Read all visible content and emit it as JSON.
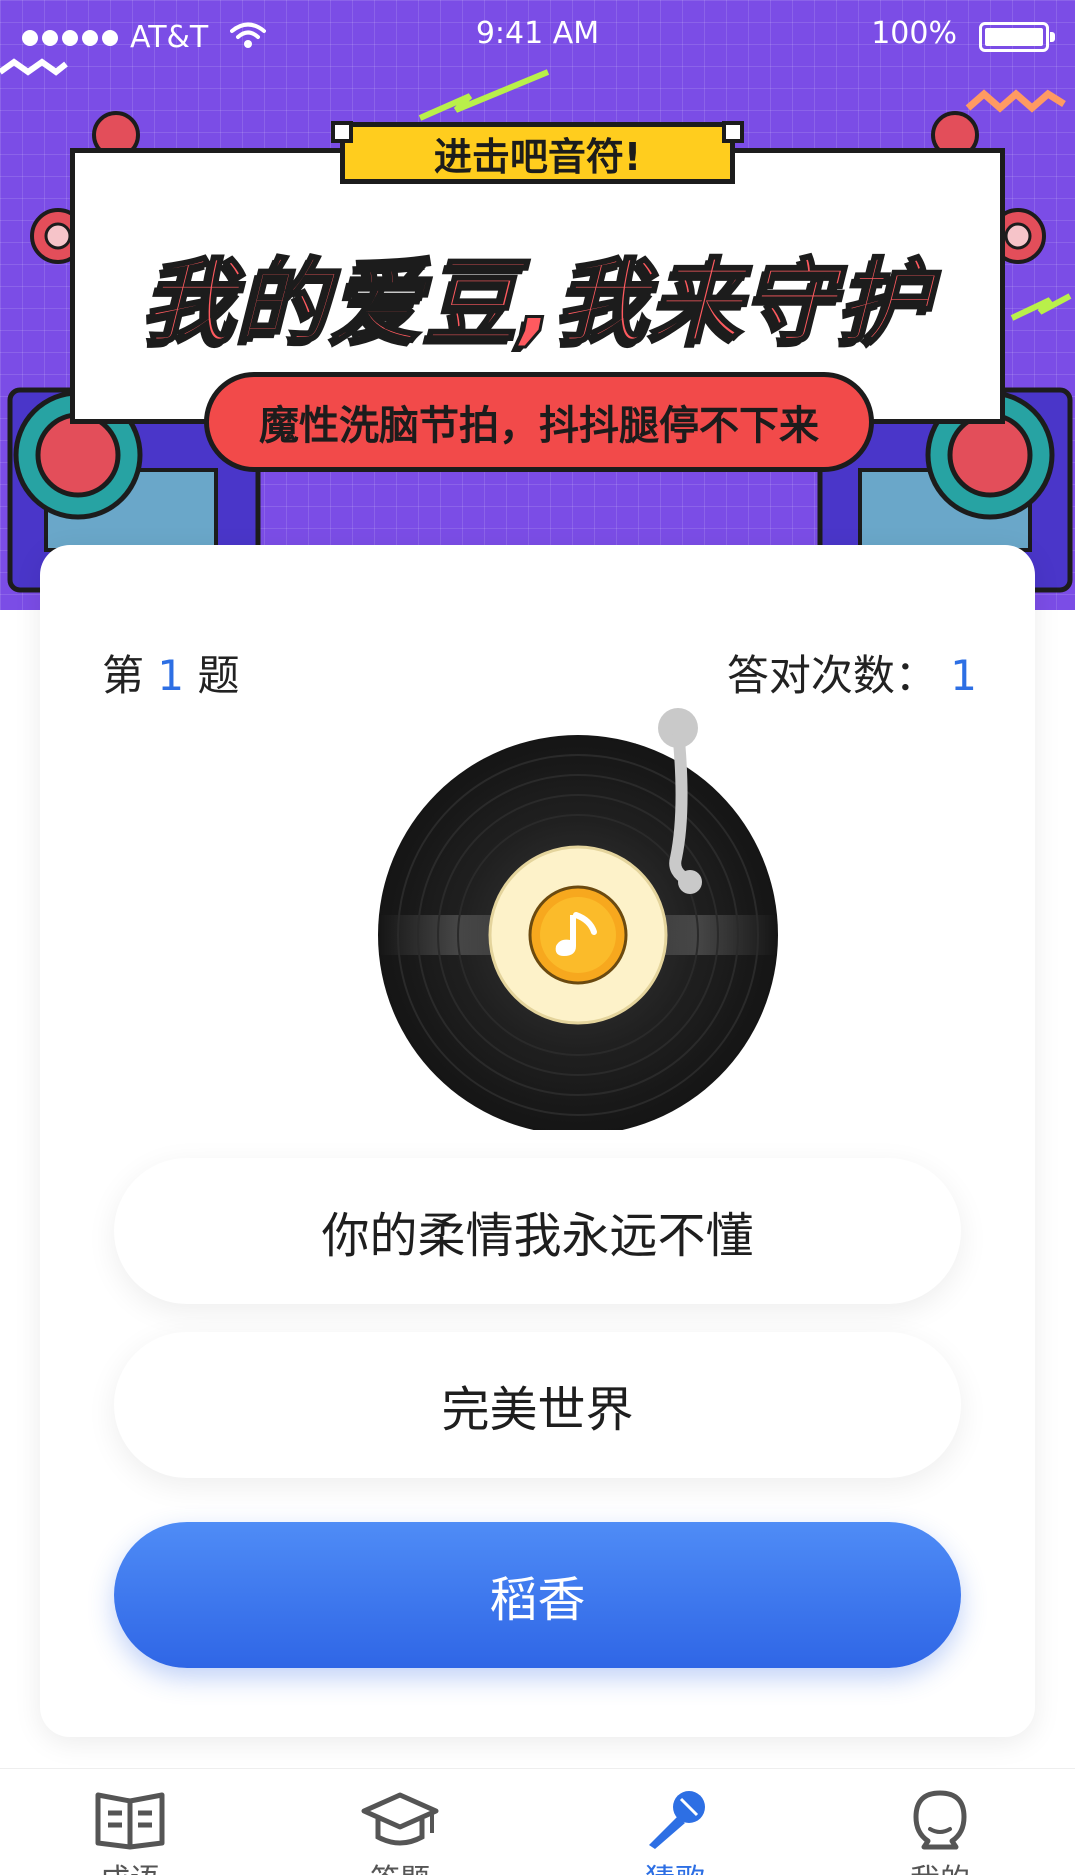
{
  "status_bar": {
    "carrier": "AT&T",
    "time": "9:41 AM",
    "battery": "100%"
  },
  "banner": {
    "tag": "进击吧音符!",
    "headline": "我的爱豆,我来守护",
    "subline": "魔性洗脑节拍，抖抖腿停不下来"
  },
  "quiz": {
    "question_prefix": "第",
    "question_number": "1",
    "question_suffix": "题",
    "correct_label": "答对次数：",
    "correct_count": "1",
    "options": [
      {
        "label": "你的柔情我永远不懂",
        "selected": false
      },
      {
        "label": "完美世界",
        "selected": false
      },
      {
        "label": "稻香",
        "selected": true
      }
    ]
  },
  "tabbar": {
    "items": [
      {
        "label": "成语",
        "icon": "book-icon",
        "active": false
      },
      {
        "label": "答题",
        "icon": "graduation-cap-icon",
        "active": false
      },
      {
        "label": "猜歌",
        "icon": "microphone-icon",
        "active": true
      },
      {
        "label": "我的",
        "icon": "user-icon",
        "active": false
      }
    ]
  },
  "colors": {
    "accent": "#2d6fe4",
    "banner": "#7b4de6",
    "tag": "#ffcd1e",
    "headline": "#ff5a5f",
    "subline": "#f24a4a"
  }
}
